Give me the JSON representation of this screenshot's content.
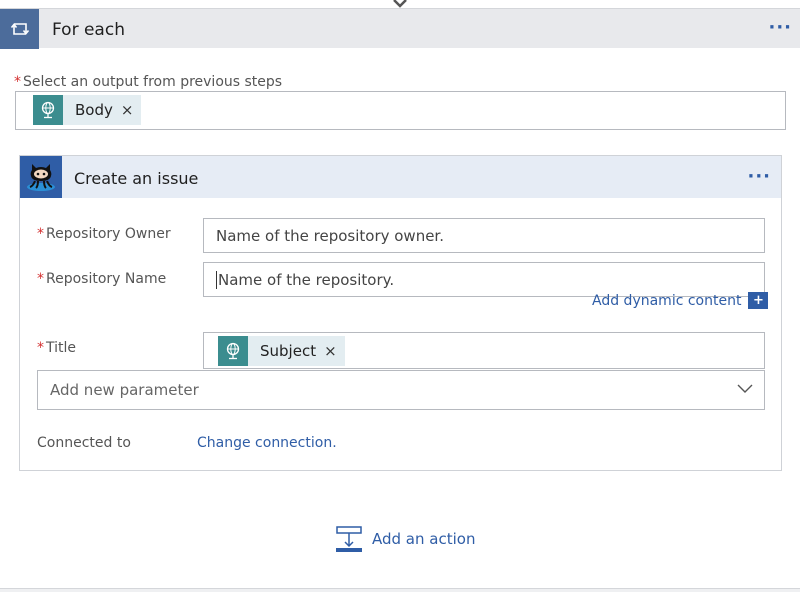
{
  "foreach": {
    "title": "For each",
    "more_glyph": "···",
    "icon": "loop-icon",
    "select_required_marker": "*",
    "select_label": "Select an output from previous steps",
    "token": {
      "label": "Body",
      "remove_glyph": "×",
      "icon": "globe-icon"
    }
  },
  "action": {
    "title": "Create an issue",
    "more_glyph": "···",
    "icon": "github-octocat-icon",
    "fields": {
      "owner": {
        "required_marker": "*",
        "label": "Repository Owner",
        "placeholder": "Name of the repository owner."
      },
      "repo": {
        "required_marker": "*",
        "label": "Repository Name",
        "placeholder": "Name of the repository."
      },
      "title": {
        "required_marker": "*",
        "label": "Title",
        "token": {
          "label": "Subject",
          "remove_glyph": "×",
          "icon": "globe-icon"
        }
      }
    },
    "dynamic_content_label": "Add dynamic content",
    "dynamic_content_plus": "+",
    "add_parameter_placeholder": "Add new parameter",
    "connected_to_label": "Connected to",
    "change_connection_label": "Change connection."
  },
  "add_action_label": "Add an action",
  "colors": {
    "accent_blue": "#2f5da6",
    "loop_header": "#4c6c9b",
    "token_teal": "#3b8d8f",
    "required_red": "#d32f2f"
  }
}
